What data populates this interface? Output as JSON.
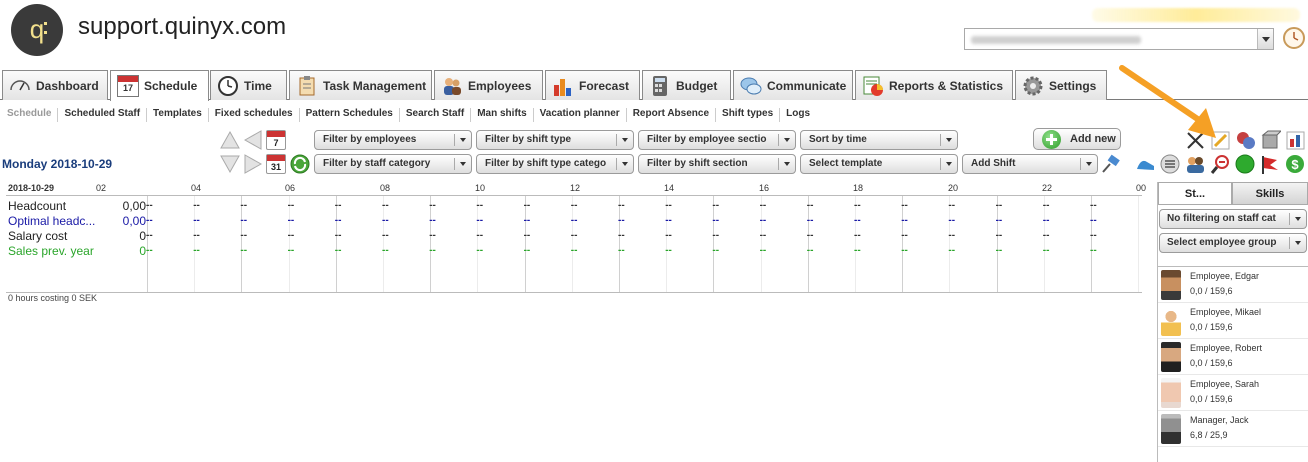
{
  "header": {
    "site_title": "support.quinyx.com"
  },
  "tabs": [
    {
      "label": "Dashboard",
      "icon": "speedometer-icon"
    },
    {
      "label": "Schedule",
      "icon": "calendar-icon",
      "active": true,
      "icon_text": "17"
    },
    {
      "label": "Time",
      "icon": "clock-icon"
    },
    {
      "label": "Task Management",
      "icon": "clipboard-icon"
    },
    {
      "label": "Employees",
      "icon": "people-icon"
    },
    {
      "label": "Forecast",
      "icon": "bar-chart-icon"
    },
    {
      "label": "Budget",
      "icon": "calculator-icon"
    },
    {
      "label": "Communicate",
      "icon": "chat-icon"
    },
    {
      "label": "Reports & Statistics",
      "icon": "report-icon"
    },
    {
      "label": "Settings",
      "icon": "gear-icon"
    }
  ],
  "subnav": [
    "Schedule",
    "Scheduled Staff",
    "Templates",
    "Fixed schedules",
    "Pattern Schedules",
    "Search Staff",
    "Man shifts",
    "Vacation planner",
    "Report Absence",
    "Shift types",
    "Logs"
  ],
  "toolbar": {
    "date": "Monday 2018-10-29",
    "cal_day": "7",
    "cal_month": "31",
    "filters_row1": [
      "Filter by employees",
      "Filter by shift type",
      "Filter by employee sectio",
      "Sort by time"
    ],
    "filters_row2": [
      "Filter by staff category",
      "Filter by shift type catego",
      "Filter by shift section",
      "Select template",
      "Add Shift"
    ],
    "add_new": "Add new"
  },
  "grid": {
    "date": "2018-10-29",
    "hours": [
      "02",
      "04",
      "06",
      "08",
      "10",
      "12",
      "14",
      "16",
      "18",
      "20",
      "22",
      "00"
    ],
    "rows": [
      {
        "label": "Headcount",
        "value": "0,00",
        "color": "#222222"
      },
      {
        "label": "Optimal headc...",
        "value": "0,00",
        "color": "#1a1aa6"
      },
      {
        "label": "Salary cost",
        "value": "0",
        "color": "#222222"
      },
      {
        "label": "Sales prev. year",
        "value": "0",
        "color": "#2aa52a"
      }
    ],
    "dash": "--",
    "cost_note": "0 hours costing 0 SEK"
  },
  "right_panel": {
    "tab_staff": "St...",
    "tab_skills": "Skills",
    "filter1": "No filtering on staff cat",
    "filter2": "Select employee group",
    "employees": [
      {
        "name": "Employee, Edgar",
        "hours": "0,0 / 159,6"
      },
      {
        "name": "Employee, Mikael",
        "hours": "0,0 / 159,6"
      },
      {
        "name": "Employee, Robert",
        "hours": "0,0 / 159,6"
      },
      {
        "name": "Employee, Sarah",
        "hours": "0,0 / 159,6"
      },
      {
        "name": "Manager, Jack",
        "hours": "6,8 / 25,9"
      }
    ]
  },
  "colors": {
    "accent_arrow": "#f5a025",
    "date_blue": "#1a3d7c"
  }
}
